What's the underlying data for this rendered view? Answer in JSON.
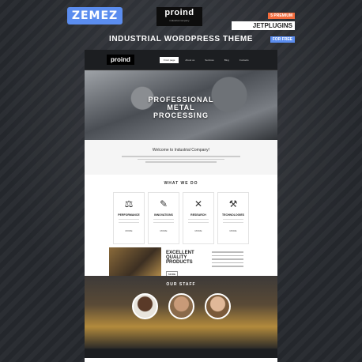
{
  "brand": {
    "zemez": "ZEMEZ"
  },
  "logo": {
    "name": "proind",
    "tagline": "industrial company"
  },
  "jet": {
    "line1": "5 PREMIUM",
    "line2": "JETPLUGINS",
    "line3": "FOR FREE"
  },
  "title": "INDUSTRIAL WORDPRESS THEME",
  "site": {
    "logo": "proind",
    "menu": [
      "Front page",
      "About us",
      "Services",
      "Blog",
      "Contacts"
    ],
    "hero": [
      "PROFESSIONAL",
      "METAL",
      "PROCESSING"
    ],
    "welcome": "Welcome to Industrial Company!",
    "what_we_do": "WHAT WE DO",
    "cards": [
      {
        "icon": "⚖",
        "title": "PERFORMANCE",
        "more": "MORE"
      },
      {
        "icon": "✎",
        "title": "INNOVATIONS",
        "more": "MORE"
      },
      {
        "icon": "✕",
        "title": "RESEARCH",
        "more": "MORE"
      },
      {
        "icon": "⚒",
        "title": "TECHNOLOGIES",
        "more": "MORE"
      }
    ],
    "quality": [
      "EXCELLENT",
      "QUALITY",
      "PRODUCTS"
    ],
    "quality_btn": "MORE",
    "our_staff": "OUR STAFF"
  }
}
